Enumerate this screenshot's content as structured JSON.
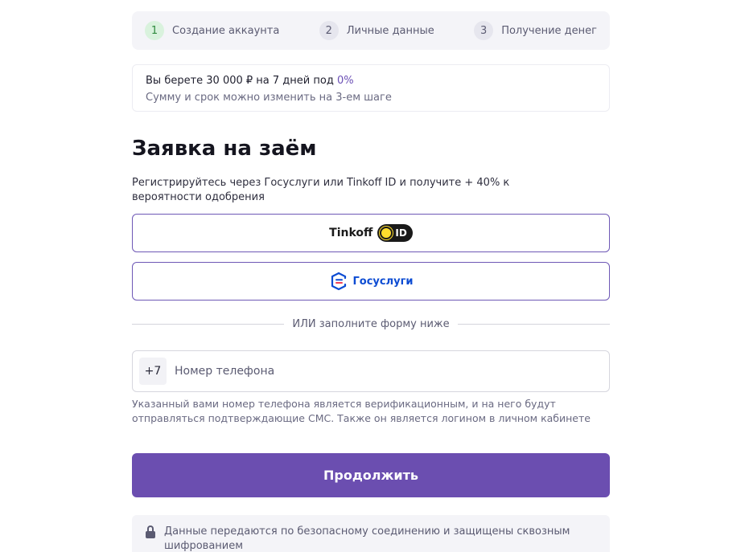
{
  "stepper": {
    "steps": [
      {
        "num": "1",
        "label": "Создание аккаунта"
      },
      {
        "num": "2",
        "label": "Личные данные"
      },
      {
        "num": "3",
        "label": "Получение денег"
      }
    ]
  },
  "summary": {
    "line1_prefix": "Вы берете 30 000 ₽ на 7 дней под ",
    "rate": "0%",
    "line2": "Сумму и срок можно изменить на 3-ем шаге"
  },
  "title": "Заявка на заём",
  "description": "Регистрируйтесь через Госуслуги или Tinkoff ID и получите + 40% к вероятности одобрения",
  "tinkoff": {
    "label": "Tinkoff",
    "badge": "ID"
  },
  "gosuslugi": {
    "label": "Госуслуги"
  },
  "divider": "ИЛИ заполните форму ниже",
  "phone": {
    "prefix": "+7",
    "placeholder": "Номер телефона",
    "value": ""
  },
  "hint": "Указанный вами номер телефона является верификационным, и на него будут отправляться подтверждающие СМС. Также он является логином в личном кабинете",
  "continue_label": "Продолжить",
  "secure_note": "Данные передаются по безопасному соединению и защищены сквозным шифрованием",
  "colors": {
    "accent": "#6b4eb0",
    "gosuslugi_blue": "#0d4cd3",
    "gosuslugi_red": "#ee3f58",
    "active_step": "#2f8a3e"
  }
}
